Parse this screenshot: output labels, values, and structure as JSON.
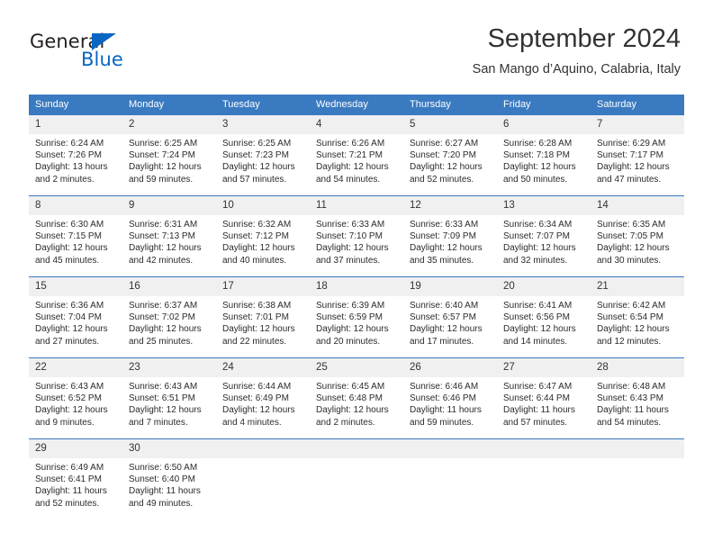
{
  "logo": {
    "word1": "General",
    "word2": "Blue",
    "triangle_color": "#0a66c2"
  },
  "header": {
    "title": "September 2024",
    "subtitle": "San Mango d’Aquino, Calabria, Italy",
    "accent_color": "#3a7ac0",
    "daynum_background": "#f0f0f0"
  },
  "weekdays": [
    "Sunday",
    "Monday",
    "Tuesday",
    "Wednesday",
    "Thursday",
    "Friday",
    "Saturday"
  ],
  "labels": {
    "sunrise": "Sunrise:",
    "sunset": "Sunset:",
    "daylight": "Daylight:"
  },
  "weeks": [
    [
      {
        "day": "1",
        "sunrise": "Sunrise: 6:24 AM",
        "sunset": "Sunset: 7:26 PM",
        "daylight_line1": "Daylight: 13 hours",
        "daylight_line2": "and 2 minutes."
      },
      {
        "day": "2",
        "sunrise": "Sunrise: 6:25 AM",
        "sunset": "Sunset: 7:24 PM",
        "daylight_line1": "Daylight: 12 hours",
        "daylight_line2": "and 59 minutes."
      },
      {
        "day": "3",
        "sunrise": "Sunrise: 6:25 AM",
        "sunset": "Sunset: 7:23 PM",
        "daylight_line1": "Daylight: 12 hours",
        "daylight_line2": "and 57 minutes."
      },
      {
        "day": "4",
        "sunrise": "Sunrise: 6:26 AM",
        "sunset": "Sunset: 7:21 PM",
        "daylight_line1": "Daylight: 12 hours",
        "daylight_line2": "and 54 minutes."
      },
      {
        "day": "5",
        "sunrise": "Sunrise: 6:27 AM",
        "sunset": "Sunset: 7:20 PM",
        "daylight_line1": "Daylight: 12 hours",
        "daylight_line2": "and 52 minutes."
      },
      {
        "day": "6",
        "sunrise": "Sunrise: 6:28 AM",
        "sunset": "Sunset: 7:18 PM",
        "daylight_line1": "Daylight: 12 hours",
        "daylight_line2": "and 50 minutes."
      },
      {
        "day": "7",
        "sunrise": "Sunrise: 6:29 AM",
        "sunset": "Sunset: 7:17 PM",
        "daylight_line1": "Daylight: 12 hours",
        "daylight_line2": "and 47 minutes."
      }
    ],
    [
      {
        "day": "8",
        "sunrise": "Sunrise: 6:30 AM",
        "sunset": "Sunset: 7:15 PM",
        "daylight_line1": "Daylight: 12 hours",
        "daylight_line2": "and 45 minutes."
      },
      {
        "day": "9",
        "sunrise": "Sunrise: 6:31 AM",
        "sunset": "Sunset: 7:13 PM",
        "daylight_line1": "Daylight: 12 hours",
        "daylight_line2": "and 42 minutes."
      },
      {
        "day": "10",
        "sunrise": "Sunrise: 6:32 AM",
        "sunset": "Sunset: 7:12 PM",
        "daylight_line1": "Daylight: 12 hours",
        "daylight_line2": "and 40 minutes."
      },
      {
        "day": "11",
        "sunrise": "Sunrise: 6:33 AM",
        "sunset": "Sunset: 7:10 PM",
        "daylight_line1": "Daylight: 12 hours",
        "daylight_line2": "and 37 minutes."
      },
      {
        "day": "12",
        "sunrise": "Sunrise: 6:33 AM",
        "sunset": "Sunset: 7:09 PM",
        "daylight_line1": "Daylight: 12 hours",
        "daylight_line2": "and 35 minutes."
      },
      {
        "day": "13",
        "sunrise": "Sunrise: 6:34 AM",
        "sunset": "Sunset: 7:07 PM",
        "daylight_line1": "Daylight: 12 hours",
        "daylight_line2": "and 32 minutes."
      },
      {
        "day": "14",
        "sunrise": "Sunrise: 6:35 AM",
        "sunset": "Sunset: 7:05 PM",
        "daylight_line1": "Daylight: 12 hours",
        "daylight_line2": "and 30 minutes."
      }
    ],
    [
      {
        "day": "15",
        "sunrise": "Sunrise: 6:36 AM",
        "sunset": "Sunset: 7:04 PM",
        "daylight_line1": "Daylight: 12 hours",
        "daylight_line2": "and 27 minutes."
      },
      {
        "day": "16",
        "sunrise": "Sunrise: 6:37 AM",
        "sunset": "Sunset: 7:02 PM",
        "daylight_line1": "Daylight: 12 hours",
        "daylight_line2": "and 25 minutes."
      },
      {
        "day": "17",
        "sunrise": "Sunrise: 6:38 AM",
        "sunset": "Sunset: 7:01 PM",
        "daylight_line1": "Daylight: 12 hours",
        "daylight_line2": "and 22 minutes."
      },
      {
        "day": "18",
        "sunrise": "Sunrise: 6:39 AM",
        "sunset": "Sunset: 6:59 PM",
        "daylight_line1": "Daylight: 12 hours",
        "daylight_line2": "and 20 minutes."
      },
      {
        "day": "19",
        "sunrise": "Sunrise: 6:40 AM",
        "sunset": "Sunset: 6:57 PM",
        "daylight_line1": "Daylight: 12 hours",
        "daylight_line2": "and 17 minutes."
      },
      {
        "day": "20",
        "sunrise": "Sunrise: 6:41 AM",
        "sunset": "Sunset: 6:56 PM",
        "daylight_line1": "Daylight: 12 hours",
        "daylight_line2": "and 14 minutes."
      },
      {
        "day": "21",
        "sunrise": "Sunrise: 6:42 AM",
        "sunset": "Sunset: 6:54 PM",
        "daylight_line1": "Daylight: 12 hours",
        "daylight_line2": "and 12 minutes."
      }
    ],
    [
      {
        "day": "22",
        "sunrise": "Sunrise: 6:43 AM",
        "sunset": "Sunset: 6:52 PM",
        "daylight_line1": "Daylight: 12 hours",
        "daylight_line2": "and 9 minutes."
      },
      {
        "day": "23",
        "sunrise": "Sunrise: 6:43 AM",
        "sunset": "Sunset: 6:51 PM",
        "daylight_line1": "Daylight: 12 hours",
        "daylight_line2": "and 7 minutes."
      },
      {
        "day": "24",
        "sunrise": "Sunrise: 6:44 AM",
        "sunset": "Sunset: 6:49 PM",
        "daylight_line1": "Daylight: 12 hours",
        "daylight_line2": "and 4 minutes."
      },
      {
        "day": "25",
        "sunrise": "Sunrise: 6:45 AM",
        "sunset": "Sunset: 6:48 PM",
        "daylight_line1": "Daylight: 12 hours",
        "daylight_line2": "and 2 minutes."
      },
      {
        "day": "26",
        "sunrise": "Sunrise: 6:46 AM",
        "sunset": "Sunset: 6:46 PM",
        "daylight_line1": "Daylight: 11 hours",
        "daylight_line2": "and 59 minutes."
      },
      {
        "day": "27",
        "sunrise": "Sunrise: 6:47 AM",
        "sunset": "Sunset: 6:44 PM",
        "daylight_line1": "Daylight: 11 hours",
        "daylight_line2": "and 57 minutes."
      },
      {
        "day": "28",
        "sunrise": "Sunrise: 6:48 AM",
        "sunset": "Sunset: 6:43 PM",
        "daylight_line1": "Daylight: 11 hours",
        "daylight_line2": "and 54 minutes."
      }
    ],
    [
      {
        "day": "29",
        "sunrise": "Sunrise: 6:49 AM",
        "sunset": "Sunset: 6:41 PM",
        "daylight_line1": "Daylight: 11 hours",
        "daylight_line2": "and 52 minutes."
      },
      {
        "day": "30",
        "sunrise": "Sunrise: 6:50 AM",
        "sunset": "Sunset: 6:40 PM",
        "daylight_line1": "Daylight: 11 hours",
        "daylight_line2": "and 49 minutes."
      },
      {
        "day": "",
        "sunrise": "",
        "sunset": "",
        "daylight_line1": "",
        "daylight_line2": ""
      },
      {
        "day": "",
        "sunrise": "",
        "sunset": "",
        "daylight_line1": "",
        "daylight_line2": ""
      },
      {
        "day": "",
        "sunrise": "",
        "sunset": "",
        "daylight_line1": "",
        "daylight_line2": ""
      },
      {
        "day": "",
        "sunrise": "",
        "sunset": "",
        "daylight_line1": "",
        "daylight_line2": ""
      },
      {
        "day": "",
        "sunrise": "",
        "sunset": "",
        "daylight_line1": "",
        "daylight_line2": ""
      }
    ]
  ]
}
